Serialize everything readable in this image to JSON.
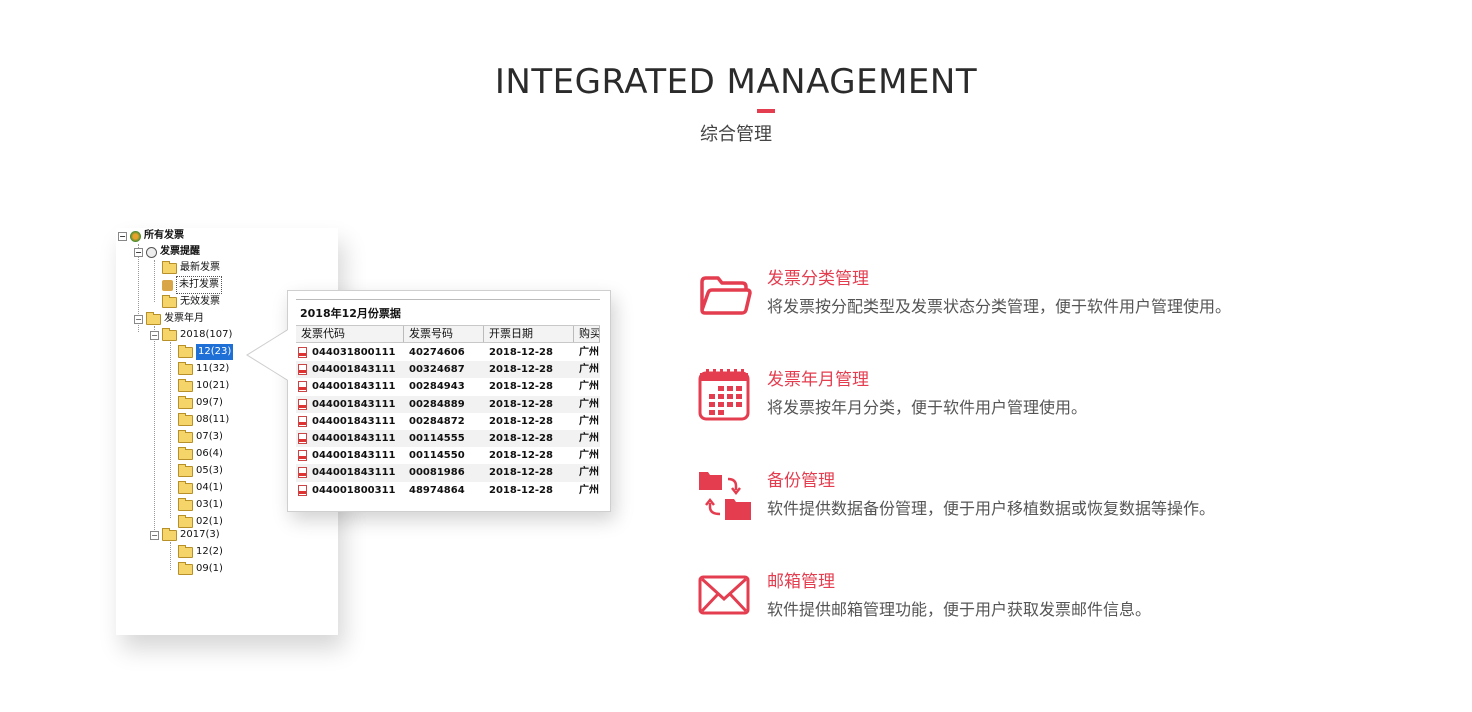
{
  "header": {
    "title": "INTEGRATED MANAGEMENT",
    "subtitle": "综合管理"
  },
  "colors": {
    "accent": "#e33d4f",
    "selection": "#1e6fd6"
  },
  "tree": {
    "root": "所有发票",
    "reminder": "发票提醒",
    "latest": "最新发票",
    "unprinted": "未打发票",
    "invalid": "无效发票",
    "year_month": "发票年月",
    "year2018": "2018(107)",
    "months2018": [
      "12(23)",
      "11(32)",
      "10(21)",
      "09(7)",
      "08(11)",
      "07(3)",
      "06(4)",
      "05(3)",
      "04(1)",
      "03(1)",
      "02(1)"
    ],
    "year2017": "2017(3)",
    "months2017": [
      "12(2)",
      "09(1)"
    ]
  },
  "invoice_table": {
    "title": "2018年12月份票据",
    "columns": [
      "发票代码",
      "发票号码",
      "开票日期",
      "购买"
    ],
    "rows": [
      [
        "044031800111",
        "40274606",
        "2018-12-28",
        "广州"
      ],
      [
        "044001843111",
        "00324687",
        "2018-12-28",
        "广州"
      ],
      [
        "044001843111",
        "00284943",
        "2018-12-28",
        "广州"
      ],
      [
        "044001843111",
        "00284889",
        "2018-12-28",
        "广州"
      ],
      [
        "044001843111",
        "00284872",
        "2018-12-28",
        "广州"
      ],
      [
        "044001843111",
        "00114555",
        "2018-12-28",
        "广州"
      ],
      [
        "044001843111",
        "00114550",
        "2018-12-28",
        "广州"
      ],
      [
        "044001843111",
        "00081986",
        "2018-12-28",
        "广州"
      ],
      [
        "044001800311",
        "48974864",
        "2018-12-28",
        "广州"
      ]
    ]
  },
  "features": [
    {
      "icon": "folder-icon",
      "title": "发票分类管理",
      "desc": "将发票按分配类型及发票状态分类管理，便于软件用户管理使用。"
    },
    {
      "icon": "calendar-icon",
      "title": "发票年月管理",
      "desc": "将发票按年月分类，便于软件用户管理使用。"
    },
    {
      "icon": "backup-icon",
      "title": "备份管理",
      "desc": "软件提供数据备份管理，便于用户移植数据或恢复数据等操作。"
    },
    {
      "icon": "envelope-icon",
      "title": "邮箱管理",
      "desc": "软件提供邮箱管理功能，便于用户获取发票邮件信息。"
    }
  ]
}
